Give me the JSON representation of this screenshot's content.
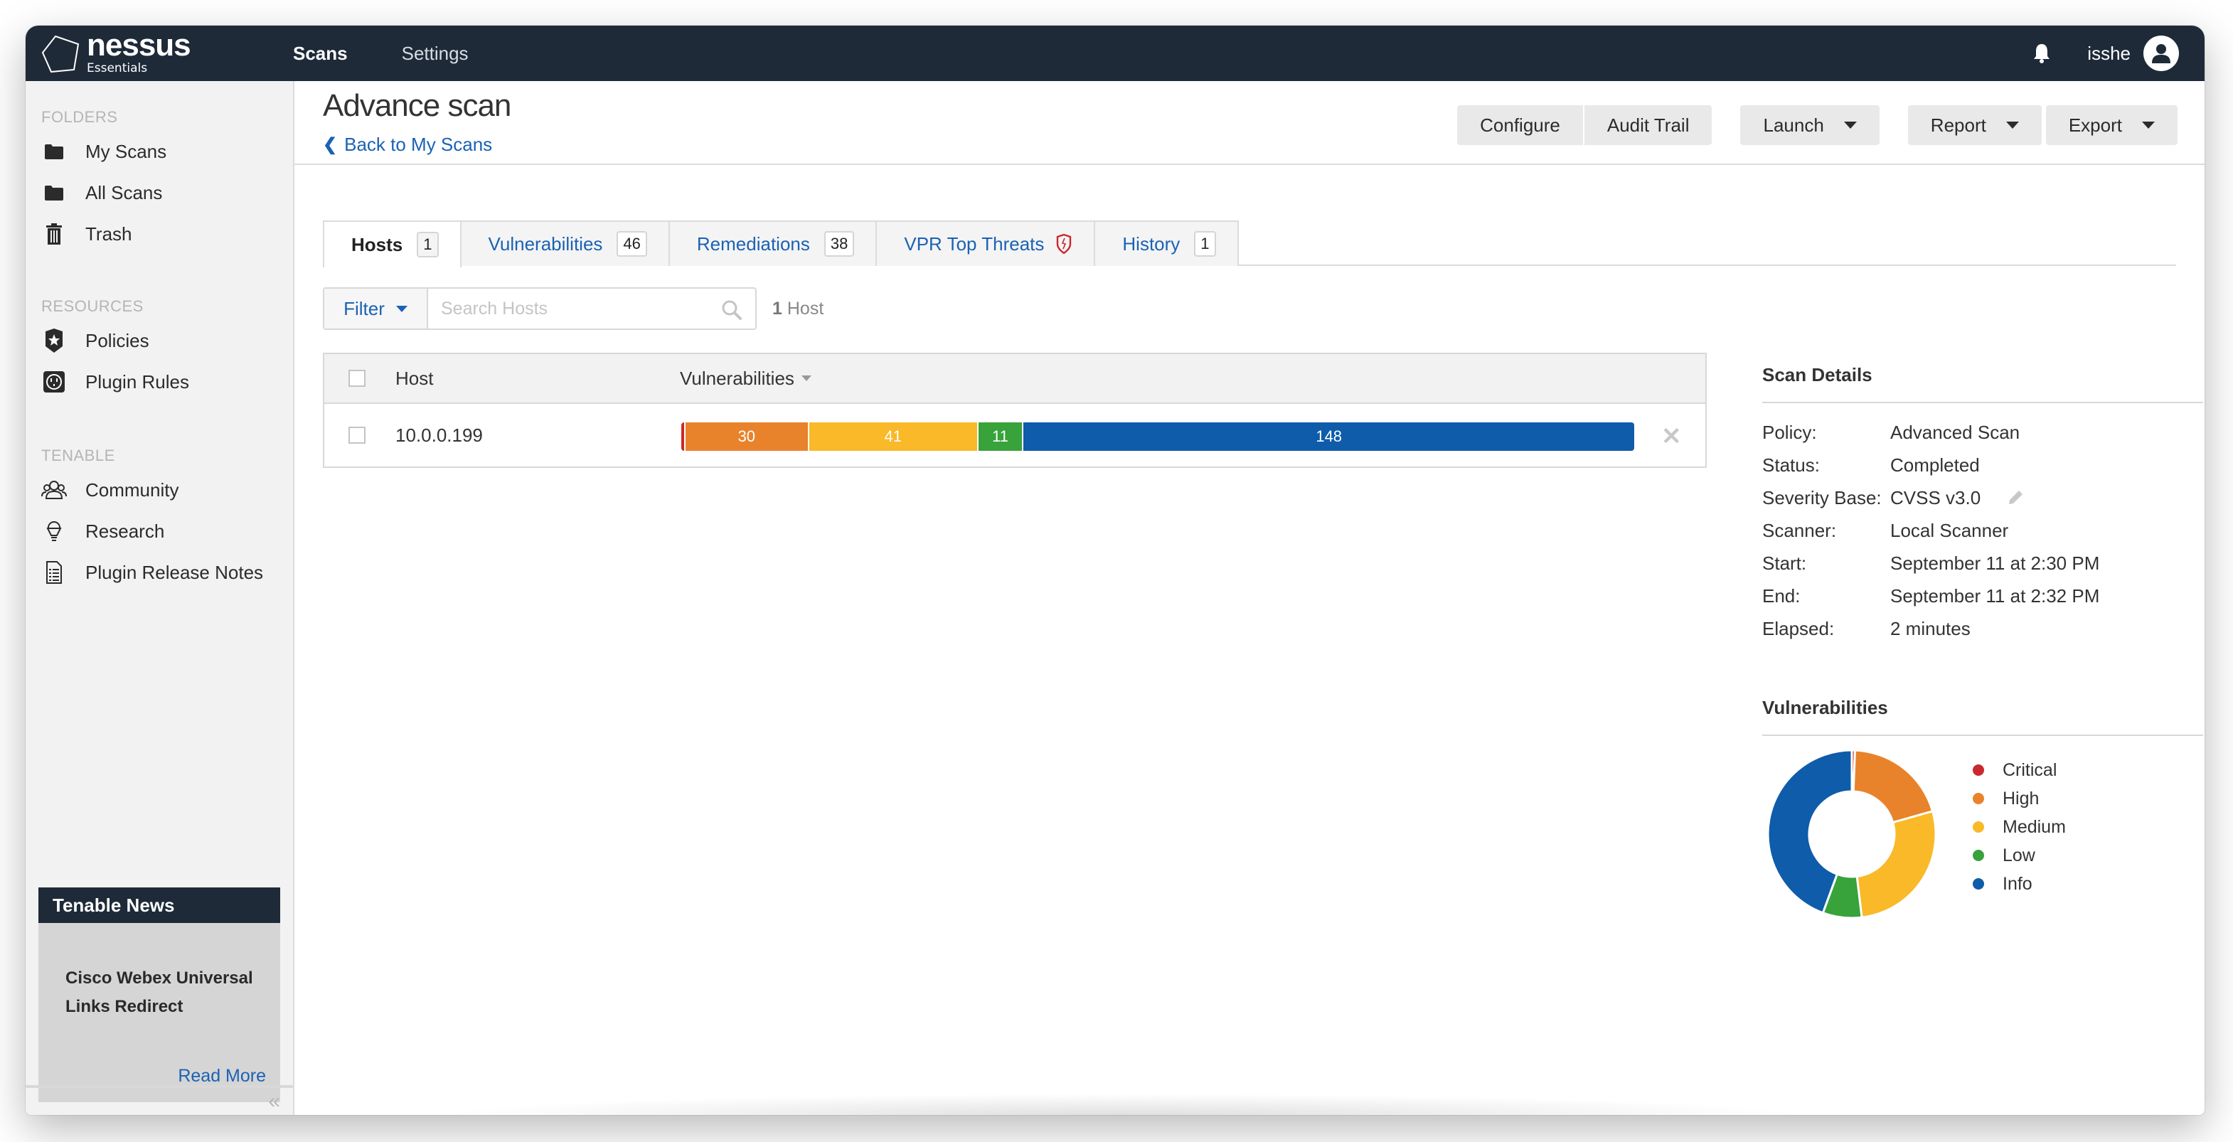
{
  "app": {
    "brand": "nessus",
    "edition": "Essentials"
  },
  "topnav": {
    "items": [
      {
        "label": "Scans",
        "active": true
      },
      {
        "label": "Settings",
        "active": false
      }
    ],
    "username": "isshe",
    "icons": {
      "notifications": "bell-icon",
      "user": "user-avatar-icon"
    }
  },
  "sidebar": {
    "sections": [
      {
        "title": "FOLDERS",
        "items": [
          {
            "label": "My Scans",
            "icon": "folder-icon"
          },
          {
            "label": "All Scans",
            "icon": "folder-icon"
          },
          {
            "label": "Trash",
            "icon": "trash-icon"
          }
        ]
      },
      {
        "title": "RESOURCES",
        "items": [
          {
            "label": "Policies",
            "icon": "shield-star-icon"
          },
          {
            "label": "Plugin Rules",
            "icon": "outlet-icon"
          }
        ]
      },
      {
        "title": "TENABLE",
        "items": [
          {
            "label": "Community",
            "icon": "community-icon"
          },
          {
            "label": "Research",
            "icon": "lightbulb-icon"
          },
          {
            "label": "Plugin Release Notes",
            "icon": "document-icon"
          }
        ]
      }
    ],
    "news": {
      "header": "Tenable News",
      "title": "Cisco Webex Universal Links Redirect",
      "link": "Read More"
    },
    "collapse_icon": "«"
  },
  "page": {
    "title": "Advance scan",
    "back_link": "Back to My Scans",
    "toolbar": {
      "configure": "Configure",
      "audit_trail": "Audit Trail",
      "launch": "Launch",
      "report": "Report",
      "export": "Export"
    },
    "tabs": [
      {
        "label": "Hosts",
        "badge": "1",
        "active": true
      },
      {
        "label": "Vulnerabilities",
        "badge": "46",
        "active": false
      },
      {
        "label": "Remediations",
        "badge": "38",
        "active": false
      },
      {
        "label": "VPR Top Threats",
        "badge": null,
        "icon": "vpr-shield-icon",
        "active": false
      },
      {
        "label": "History",
        "badge": "1",
        "active": false
      }
    ],
    "filter": {
      "label": "Filter",
      "search_placeholder": "Search Hosts",
      "search_value": "",
      "count_number": "1",
      "count_label": "Host"
    },
    "table": {
      "columns": [
        "Host",
        "Vulnerabilities"
      ],
      "rows": [
        {
          "host": "10.0.0.199",
          "severity_counts": {
            "critical": 1,
            "high": 30,
            "medium": 41,
            "low": 11,
            "info": 148
          },
          "severity_labels": {
            "critical": "",
            "high": "30",
            "medium": "41",
            "low": "11",
            "info": "148"
          }
        }
      ]
    }
  },
  "scan_details": {
    "title": "Scan Details",
    "rows": [
      {
        "key": "Policy:",
        "value": "Advanced Scan"
      },
      {
        "key": "Status:",
        "value": "Completed"
      },
      {
        "key": "Severity Base:",
        "value": "CVSS v3.0",
        "editable": true
      },
      {
        "key": "Scanner:",
        "value": "Local Scanner"
      },
      {
        "key": "Start:",
        "value": "September 11 at 2:30 PM"
      },
      {
        "key": "End:",
        "value": "September 11 at 2:32 PM"
      },
      {
        "key": "Elapsed:",
        "value": "2 minutes"
      }
    ]
  },
  "severity_colors": {
    "critical": "#c9282e",
    "high": "#e8832b",
    "medium": "#f9b928",
    "low": "#38a23b",
    "info": "#0e5caa"
  },
  "chart_data": {
    "type": "pie",
    "variant": "donut",
    "title": "Vulnerabilities",
    "categories": [
      "Critical",
      "High",
      "Medium",
      "Low",
      "Info"
    ],
    "values_percent_estimated": [
      0.6,
      20,
      27.5,
      7.5,
      44.4
    ],
    "colors": [
      "#c9282e",
      "#e8832b",
      "#f9b928",
      "#38a23b",
      "#0e5caa"
    ],
    "legend": "right"
  }
}
